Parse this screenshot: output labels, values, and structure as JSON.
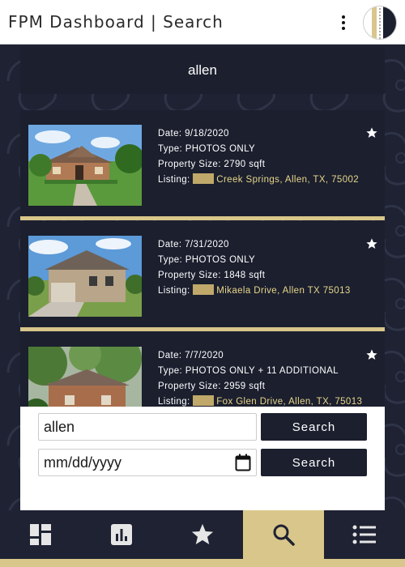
{
  "header": {
    "title": "FPM Dashboard | Search"
  },
  "query": {
    "heading": "allen"
  },
  "results": [
    {
      "date": "Date: 9/18/2020",
      "type": "Type: PHOTOS ONLY",
      "size": "Property Size: 2790 sqft",
      "listing_label": "Listing:",
      "address": "Creek Springs, Allen, TX, 75002",
      "starred": false
    },
    {
      "date": "Date: 7/31/2020",
      "type": "Type: PHOTOS ONLY",
      "size": "Property Size: 1848 sqft",
      "listing_label": "Listing:",
      "address": "Mikaela Drive, Allen TX 75013",
      "starred": false
    },
    {
      "date": "Date: 7/7/2020",
      "type": "Type: PHOTOS ONLY + 11 ADDITIONAL",
      "size": "Property Size: 2959 sqft",
      "listing_label": "Listing:",
      "address": "Fox Glen Drive, Allen, TX, 75013",
      "starred": false
    }
  ],
  "search": {
    "text_value": "allen",
    "date_placeholder": "mm/dd/yyyy",
    "search_button_label": "Search",
    "date_search_button_label": "Search"
  },
  "nav": {
    "items": [
      {
        "icon": "dashboard-icon",
        "active": false
      },
      {
        "icon": "bar-chart-icon",
        "active": false
      },
      {
        "icon": "star-icon",
        "active": false
      },
      {
        "icon": "search-icon",
        "active": true
      },
      {
        "icon": "list-icon",
        "active": false
      }
    ]
  },
  "colors": {
    "navy": "#1b1f2e",
    "gold": "#d9c68a",
    "address_gold": "#e8d68a"
  }
}
